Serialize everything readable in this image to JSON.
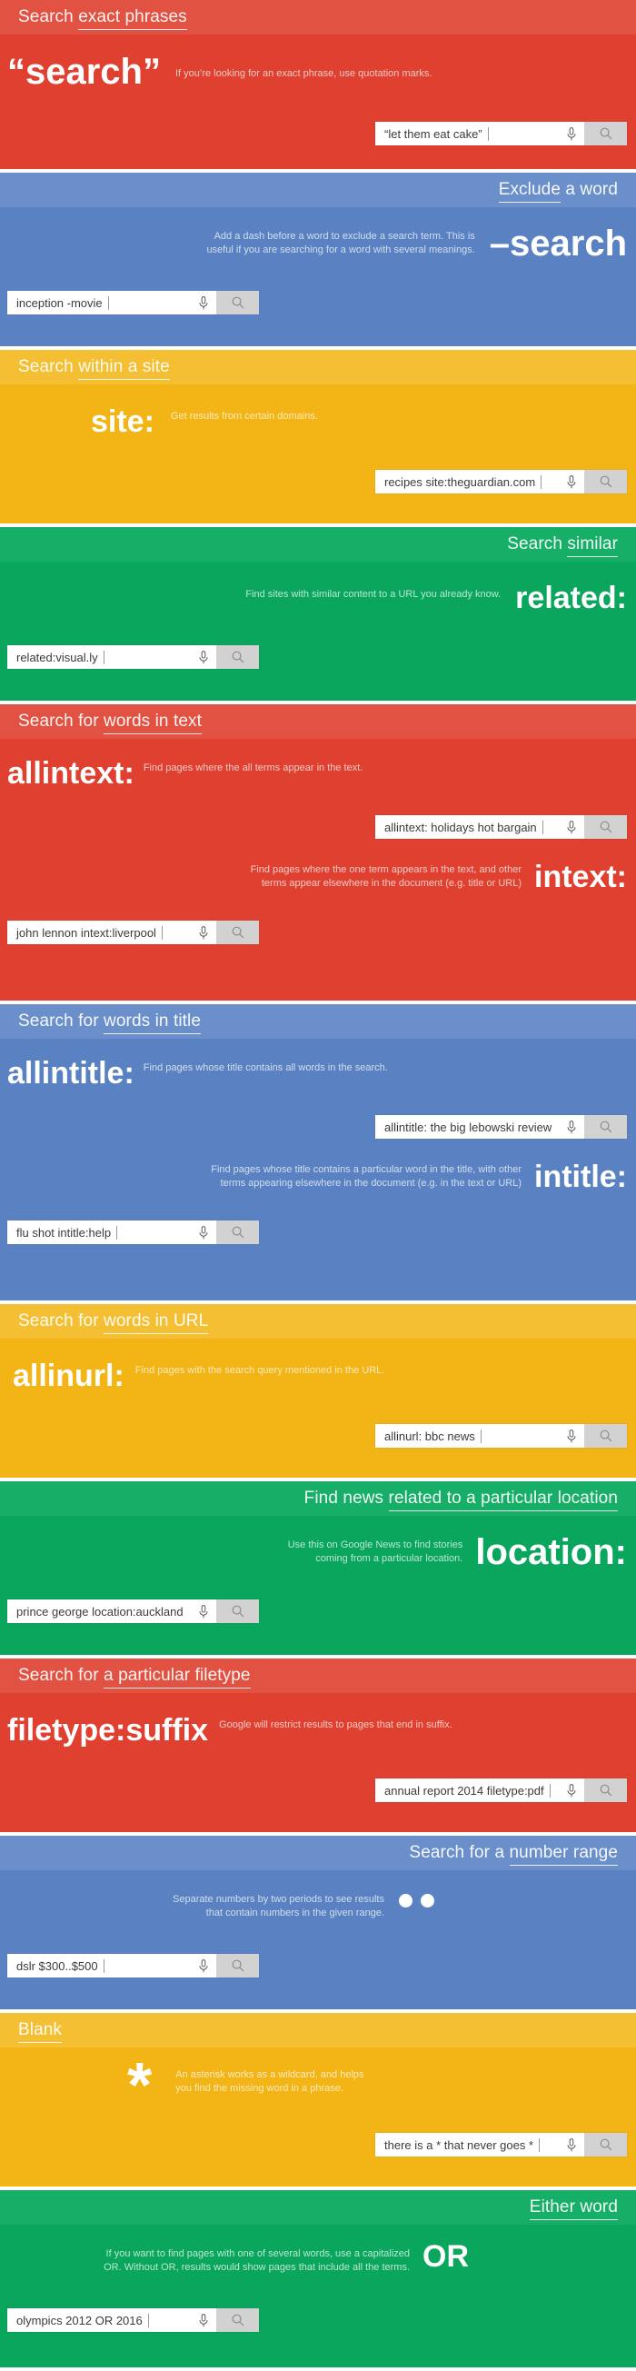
{
  "colors": {
    "red": "#e04030",
    "red_header": "#e25243",
    "blue": "#5a82c2",
    "blue_header": "#6b8fcb",
    "yellow": "#f3b416",
    "yellow_header": "#f5bf34",
    "green": "#0ba65d",
    "green_header": "#17ae68",
    "white": "#ffffff",
    "search_button": "#d2d2d2",
    "input_text": "#3b3b3b"
  },
  "icons": {
    "mic": "microphone-icon",
    "search": "search-icon"
  },
  "panels": [
    {
      "id": "exact-phrases",
      "color": "red",
      "header": {
        "plain": "Search ",
        "underlined": "exact phrases",
        "align": "left"
      },
      "keyword": "“search”",
      "keyword_size": "kw-xl",
      "keyword_align": "left",
      "description": "If you’re looking for an exact phrase, use quotation marks.",
      "search_value": "“let them eat cake”",
      "search_align": "right"
    },
    {
      "id": "exclude-word",
      "color": "blue",
      "header": {
        "plain": "",
        "underlined": "Exclude",
        "suffix": " a word",
        "align": "right"
      },
      "keyword": "–search",
      "keyword_size": "kw-xl",
      "keyword_align": "right",
      "description": "Add a dash before a word to exclude a search term. This is\nuseful if you are searching for a word with several meanings.",
      "search_value": "inception -movie",
      "search_align": "left"
    },
    {
      "id": "search-within-site",
      "color": "yellow",
      "header": {
        "plain": "Search ",
        "underlined": "within a site",
        "align": "left"
      },
      "keyword": "site:",
      "keyword_size": "kw-lg",
      "keyword_align": "center-left",
      "description": "Get results from certain domains.",
      "search_value": "recipes site:theguardian.com",
      "search_align": "right"
    },
    {
      "id": "search-similar",
      "color": "green",
      "header": {
        "plain": "Search ",
        "underlined": "similar",
        "align": "right"
      },
      "keyword": "related:",
      "keyword_size": "kw-lg",
      "keyword_align": "right",
      "description": "Find sites with similar content to a URL you already know.",
      "search_value": "related:visual.ly",
      "search_align": "left"
    },
    {
      "id": "words-in-text",
      "color": "red",
      "header": {
        "plain": "Search for ",
        "underlined": "words in text",
        "align": "left"
      },
      "sub": [
        {
          "keyword": "allintext:",
          "keyword_size": "kw-lg",
          "keyword_align": "left",
          "description": "Find pages where the all terms appear in the text.",
          "search_value": "allintext: holidays hot bargain",
          "search_align": "right"
        },
        {
          "keyword": "intext:",
          "keyword_size": "kw-lg",
          "keyword_align": "right",
          "description": "Find pages where the one term appears in the text, and other\nterms appear elsewhere in the document (e.g. title or URL)",
          "search_value": "john lennon intext:liverpool",
          "search_align": "left"
        }
      ]
    },
    {
      "id": "words-in-title",
      "color": "blue",
      "header": {
        "plain": "Search for ",
        "underlined": "words in title",
        "align": "left"
      },
      "sub": [
        {
          "keyword": "allintitle:",
          "keyword_size": "kw-lg",
          "keyword_align": "left",
          "description": "Find pages whose title contains all words in the search.",
          "search_value": "allintitle: the big lebowski review",
          "search_align": "right"
        },
        {
          "keyword": "intitle:",
          "keyword_size": "kw-lg",
          "keyword_align": "right",
          "description": "Find pages whose title contains a particular word in the title, with other\nterms appearing elsewhere in the document (e.g. in the text or URL)",
          "search_value": "flu shot intitle:help",
          "search_align": "left"
        }
      ]
    },
    {
      "id": "words-in-url",
      "color": "yellow",
      "header": {
        "plain": "Search for ",
        "underlined": "words in URL",
        "align": "left"
      },
      "keyword": "allinurl:",
      "keyword_size": "kw-lg",
      "keyword_align": "left",
      "description": "Find pages with the search query mentioned in the URL.",
      "search_value": "allinurl: bbc news",
      "search_align": "right"
    },
    {
      "id": "news-location",
      "color": "green",
      "header": {
        "plain": "Find news ",
        "underlined": "related to a particular location",
        "align": "right"
      },
      "keyword": "location:",
      "keyword_size": "kw-xl",
      "keyword_align": "right",
      "description": "Use this on Google News to find stories\ncoming from a particular location.",
      "search_value": "prince george location:auckland",
      "search_align": "left"
    },
    {
      "id": "particular-filetype",
      "color": "red",
      "header": {
        "plain": "Search for ",
        "underlined": "a particular filetype",
        "align": "left"
      },
      "keyword": "filetype:suffix",
      "keyword_size": "kw-lg",
      "keyword_align": "left",
      "description": "Google will restrict results to pages that end in suffix.",
      "search_value": "annual report 2014 filetype:pdf",
      "search_align": "right"
    },
    {
      "id": "number-range",
      "color": "blue",
      "header": {
        "plain": "Search for a ",
        "underlined": "number range",
        "align": "right"
      },
      "keyword": "",
      "keyword_glyph": "two-dots",
      "keyword_size": "kw-lg",
      "keyword_align": "right",
      "description": "Separate numbers by two periods to see results\nthat contain numbers in the given range.",
      "search_value": "dslr $300..$500",
      "search_align": "left"
    },
    {
      "id": "blank-wildcard",
      "color": "yellow",
      "header": {
        "plain": "",
        "underlined": "Blank",
        "align": "left"
      },
      "keyword": "*",
      "keyword_glyph": "asterisk",
      "keyword_size": "kw-xl",
      "keyword_align": "center",
      "description": "An asterisk works as a wildcard, and helps\nyou find the missing word in a phrase.",
      "search_value": "there is a * that never goes *",
      "search_align": "right"
    },
    {
      "id": "either-word",
      "color": "green",
      "header": {
        "plain": "",
        "underlined": "Either word",
        "align": "right"
      },
      "keyword": "OR",
      "keyword_size": "kw-lg",
      "keyword_align": "right",
      "description": "If you want to find pages with one of several words, use a capitalized\nOR. Without OR, results would show pages that include all the terms.",
      "search_value": "olympics 2012 OR 2016",
      "search_align": "left"
    }
  ]
}
